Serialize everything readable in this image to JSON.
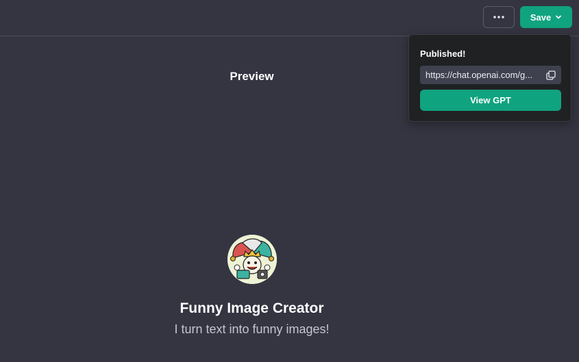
{
  "header": {
    "more_icon": "ellipsis-icon",
    "save_label": "Save",
    "save_icon": "chevron-down-icon"
  },
  "preview": {
    "title": "Preview"
  },
  "publish_popover": {
    "title": "Published!",
    "link": "https://chat.openai.com/g...",
    "copy_icon": "copy-icon",
    "view_button": "View GPT"
  },
  "gpt": {
    "name": "Funny Image Creator",
    "description": "I turn text into funny images!"
  },
  "colors": {
    "background": "#343541",
    "accent": "#10a37f",
    "popover": "#202123"
  }
}
